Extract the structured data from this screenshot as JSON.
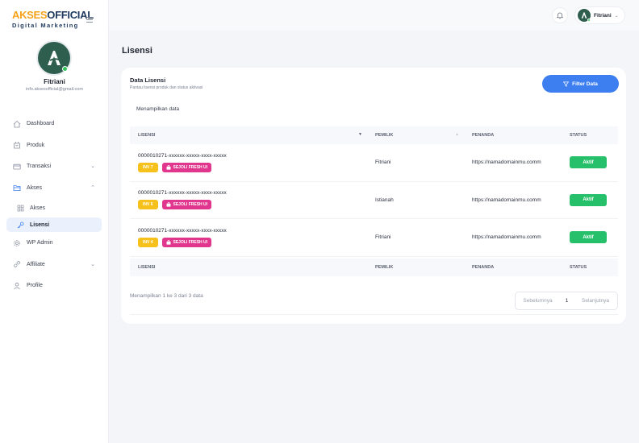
{
  "brand": {
    "name_part1": "AKSES",
    "name_part2": "OFFICIAL",
    "tagline": "Digital Marketing"
  },
  "profile": {
    "name": "Fitriani",
    "email": "info.aksesofficial@gmail.com"
  },
  "nav": [
    {
      "label": "Dashboard",
      "icon": "home-icon"
    },
    {
      "label": "Produk",
      "icon": "box-icon"
    },
    {
      "label": "Transaksi",
      "icon": "card-icon",
      "has_chevron": true
    },
    {
      "label": "Akses",
      "icon": "folder-icon",
      "has_chevron": true,
      "expanded": true
    },
    {
      "label": "Akses",
      "icon": "grid-icon",
      "sub": true
    },
    {
      "label": "Lisensi",
      "icon": "key-icon",
      "sub": true,
      "active": true
    },
    {
      "label": "WP Admin",
      "icon": "gear-icon"
    },
    {
      "label": "Affiliate",
      "icon": "link-icon",
      "has_chevron": true
    },
    {
      "label": "Profile",
      "icon": "user-icon"
    }
  ],
  "topbar": {
    "user_name": "Fitriani"
  },
  "page": {
    "title": "Lisensi"
  },
  "card": {
    "title": "Data Lisensi",
    "subtitle": "Pantau lisensi produk dan status aktivasi",
    "filter_label": "Filter Data",
    "showing_label": "Menampilkan data"
  },
  "table": {
    "columns": [
      "LISENSI",
      "PEMILIK",
      "PENANDA",
      "STATUS"
    ],
    "rows": [
      {
        "license": "0000010271-xxxxxx-xxxxx-xxxx-xxxxx",
        "invoice": "INV 7",
        "product": "SEJOLI FRESH UI",
        "owner": "Fitriani",
        "marker": "https://namadomainmu.comm",
        "status": "Aktif"
      },
      {
        "license": "0000010271-xxxxxx-xxxxx-xxxx-xxxxx",
        "invoice": "INV 6",
        "product": "SEJOLI FRESH UI",
        "owner": "Istianah",
        "marker": "https://namadomainmu.comm",
        "status": "Aktif"
      },
      {
        "license": "0000010271-xxxxxx-xxxxx-xxxx-xxxxx",
        "invoice": "INV 4",
        "product": "SEJOLI FRESH UI",
        "owner": "Fitriani",
        "marker": "https://namadomainmu.comm",
        "status": "Aktif"
      }
    ]
  },
  "pagination": {
    "info": "Menampilkan 1 ke 3 dari 3 data",
    "prev": "Sebelumnya",
    "current": "1",
    "next": "Selanjutnya"
  },
  "colors": {
    "primary": "#3d7ef0",
    "success": "#27c06a",
    "invoice": "#f6c11b",
    "product": "#e0368d",
    "brand_orange": "#f5a31a",
    "brand_navy": "#1f3a5f"
  }
}
